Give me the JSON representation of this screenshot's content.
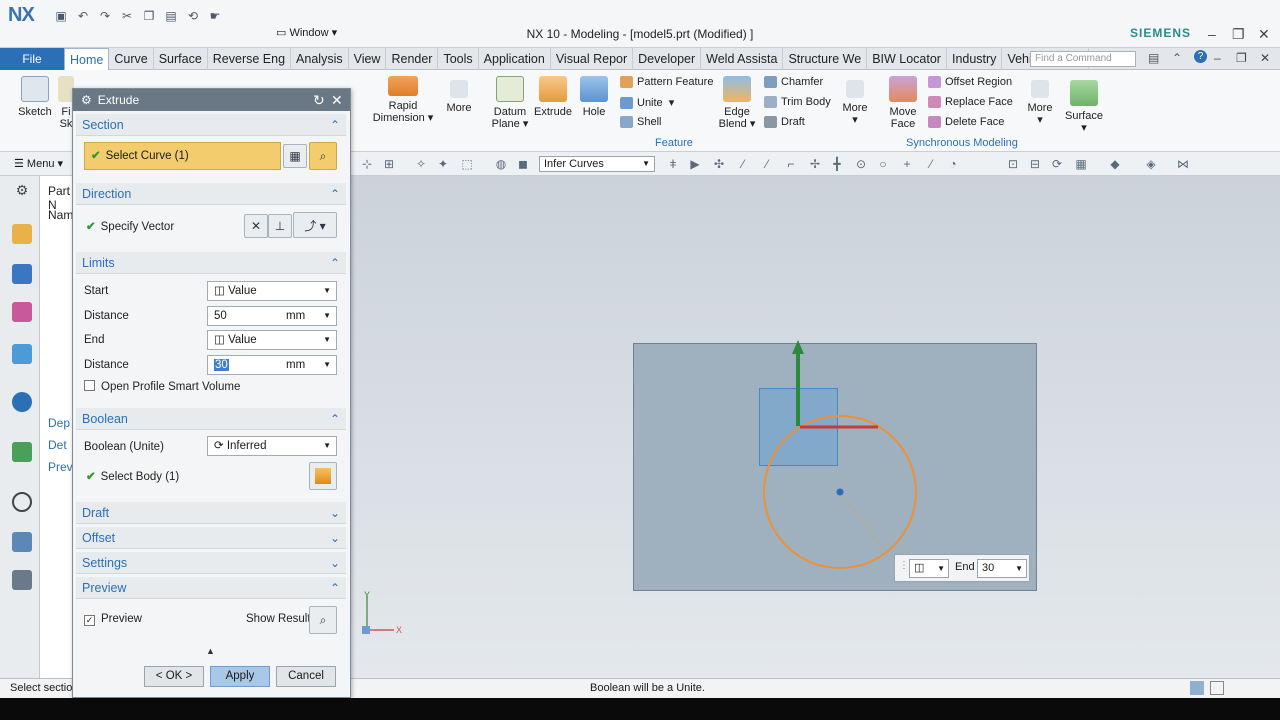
{
  "app": {
    "logo": "NX",
    "title": "NX 10 - Modeling - [model5.prt (Modified) ]",
    "window_menu": "Window",
    "brand": "SIEMENS"
  },
  "tabs": {
    "file": "File",
    "items": [
      "Home",
      "Curve",
      "Surface",
      "Reverse Eng",
      "Analysis",
      "View",
      "Render",
      "Tools",
      "Application",
      "Visual Repor",
      "Developer",
      "Weld Assista",
      "Structure We",
      "BIW Locator",
      "Industry",
      "Vehicle Desig"
    ],
    "find_placeholder": "Find a Command"
  },
  "ribbon": {
    "sketch": "Sketch",
    "fi": "Fi",
    "sk": "Sk",
    "rapid_dim_1": "Rapid",
    "rapid_dim_2": "Dimension",
    "more1": "More",
    "datum_1": "Datum",
    "datum_2": "Plane",
    "extrude": "Extrude",
    "hole": "Hole",
    "pattern": "Pattern Feature",
    "unite": "Unite",
    "shell": "Shell",
    "edge_1": "Edge",
    "edge_2": "Blend",
    "chamfer": "Chamfer",
    "trim": "Trim Body",
    "draft": "Draft",
    "more2": "More",
    "feature_label": "Feature",
    "move_1": "Move",
    "move_2": "Face",
    "offset_region": "Offset Region",
    "replace_face": "Replace Face",
    "delete_face": "Delete Face",
    "more3": "More",
    "surface": "Surface",
    "sync_label": "Synchronous Modeling"
  },
  "toolbar": {
    "menu": "Menu",
    "infer": "Infer Curves"
  },
  "nav": {
    "part": "Part N",
    "name": "Nam",
    "dep": "Dep",
    "det": "Det",
    "prev": "Prev"
  },
  "dialog": {
    "title": "Extrude",
    "section": "Section",
    "select_curve": "Select Curve (1)",
    "direction": "Direction",
    "specify_vector": "Specify Vector",
    "limits": "Limits",
    "start_label": "Start",
    "start_value": "Value",
    "distance1_label": "Distance",
    "distance1_value": "50",
    "distance1_unit": "mm",
    "end_label": "End",
    "end_value": "Value",
    "distance2_label": "Distance",
    "distance2_value": "30",
    "distance2_unit": "mm",
    "open_profile": "Open Profile Smart Volume",
    "boolean": "Boolean",
    "boolean_label": "Boolean (Unite)",
    "boolean_value": "Inferred",
    "select_body": "Select Body (1)",
    "draft": "Draft",
    "offset": "Offset",
    "settings": "Settings",
    "preview": "Preview",
    "preview_cb": "Preview",
    "show_result": "Show Result",
    "ok": "< OK >",
    "apply": "Apply",
    "cancel": "Cancel"
  },
  "graphics": {
    "handle_end_label": "End",
    "handle_end_value": "30",
    "axis_x": "X",
    "axis_y": "Y"
  },
  "status": {
    "left": "Select sectio",
    "center": "Boolean will be a Unite."
  }
}
